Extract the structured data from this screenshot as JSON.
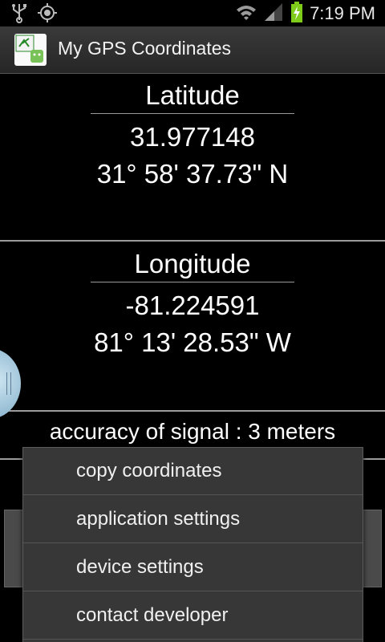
{
  "status_bar": {
    "time": "7:19 PM",
    "icons": [
      "usb-icon",
      "gps-icon",
      "wifi-icon",
      "signal-icon",
      "battery-charging-icon"
    ]
  },
  "app": {
    "title": "My GPS Coordinates",
    "icon": "app-gps-android-icon"
  },
  "latitude": {
    "label": "Latitude",
    "decimal": "31.977148",
    "dms": "31° 58' 37.73\" N"
  },
  "longitude": {
    "label": "Longitude",
    "decimal": "-81.224591",
    "dms": "81° 13' 28.53\" W"
  },
  "accuracy_text": "accuracy of signal : 3 meters",
  "menu": {
    "items": [
      {
        "label": "copy coordinates"
      },
      {
        "label": "application settings"
      },
      {
        "label": "device settings"
      },
      {
        "label": "contact developer"
      }
    ]
  },
  "colors": {
    "background": "#000000",
    "menu_bg": "#373737",
    "divider": "#9b9b9b",
    "handle": "#8fb8d0",
    "battery": "#7ecb1a"
  }
}
